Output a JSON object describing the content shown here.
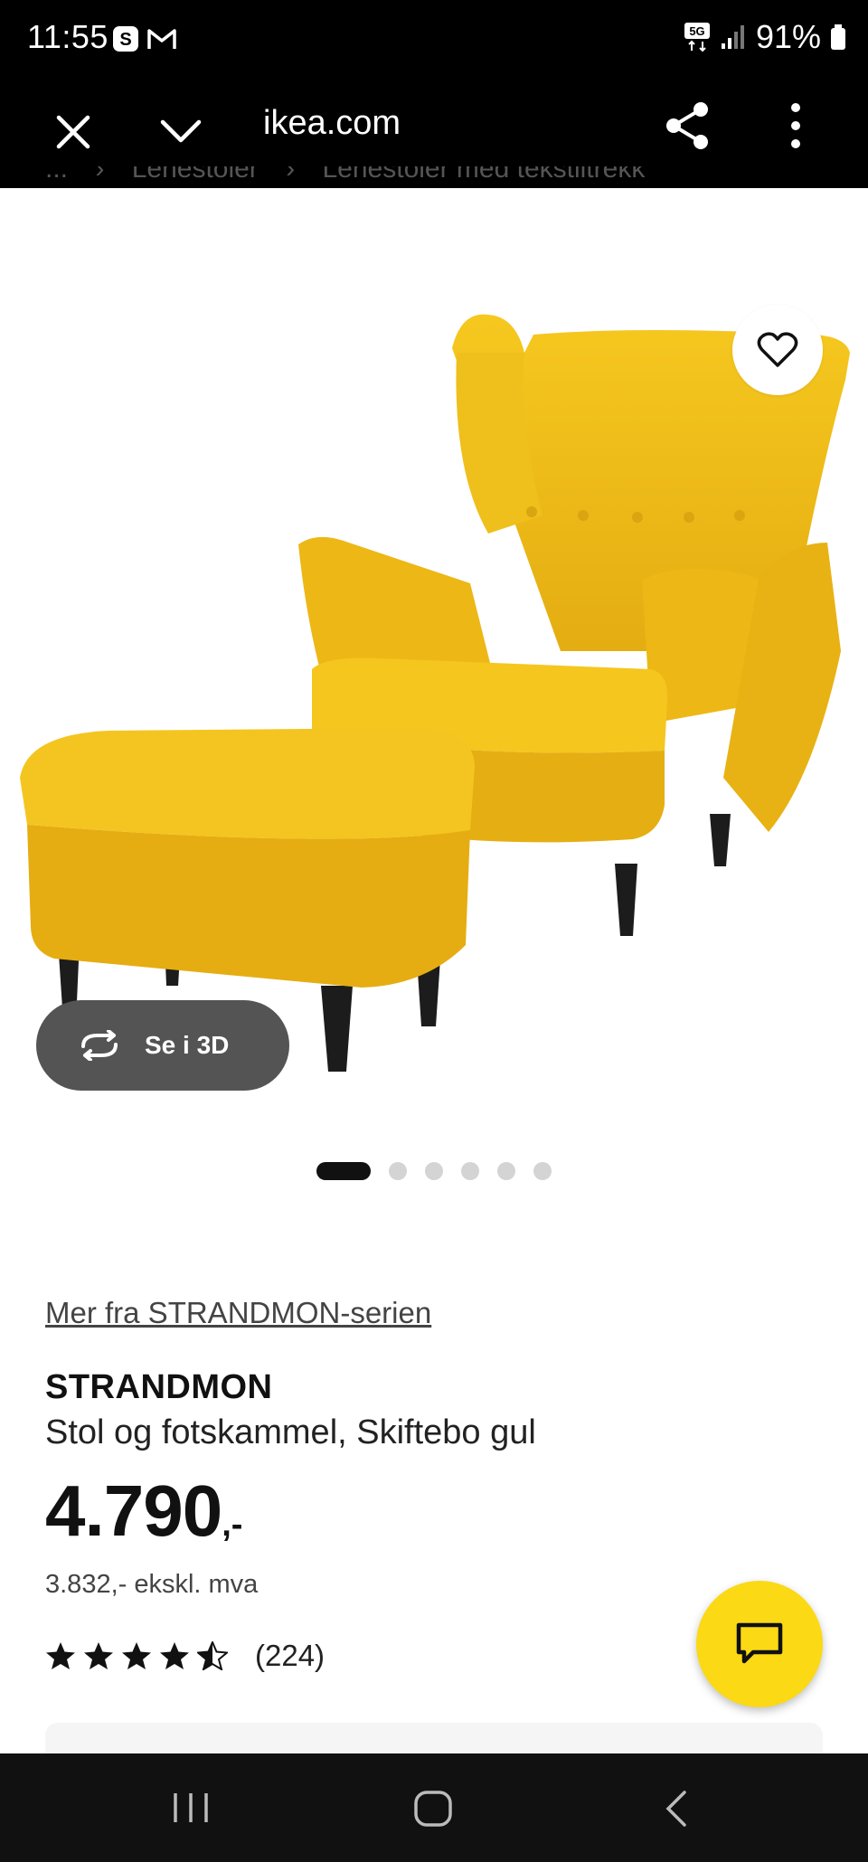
{
  "status_bar": {
    "time": "11:55",
    "network": "5G",
    "battery": "91%",
    "icons": [
      "s-app-icon",
      "gmail-icon",
      "signal-icon",
      "battery-icon"
    ]
  },
  "browser": {
    "url": "ikea.com"
  },
  "breadcrumb": [
    "...",
    "Lenestoler",
    "Lenestoler med tekstiltrekk"
  ],
  "gallery": {
    "see_3d_label": "Se i 3D",
    "total_images": 6,
    "active_index": 0
  },
  "product": {
    "series_link": "Mer fra STRANDMON-serien",
    "name": "STRANDMON",
    "description": "Stol og fotskammel, Skiftebo gul",
    "price_main": "4.790",
    "price_suffix": ",-",
    "price_ex_vat": "3.832,- ekskl. mva",
    "rating_stars": 4.5,
    "review_count": "(224)"
  },
  "colors": {
    "accent_yellow": "#fbd914",
    "product_yellow": "#f2c21a",
    "button_dark": "#545454"
  }
}
